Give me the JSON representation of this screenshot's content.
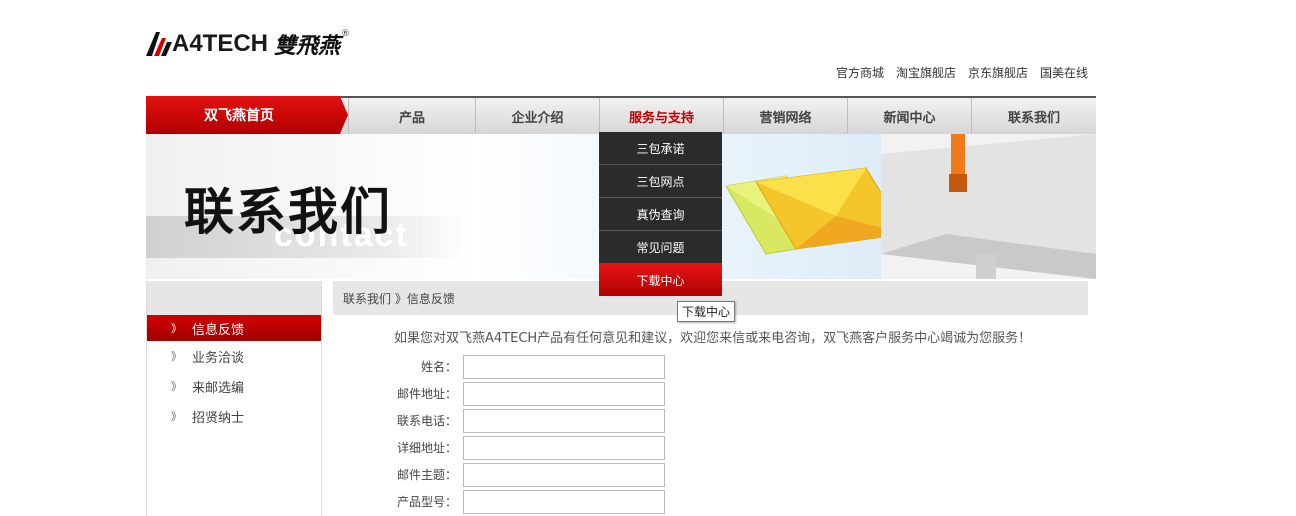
{
  "logo": {
    "text": "A4TECH",
    "cn": "雙飛燕",
    "reg": "®"
  },
  "toplinks": [
    "官方商城",
    "淘宝旗舰店",
    "京东旗舰店",
    "国美在线"
  ],
  "nav": {
    "home": "双飞燕首页",
    "items": [
      "产品",
      "企业介绍",
      "服务与支持",
      "营销网络",
      "新闻中心",
      "联系我们"
    ],
    "active_index": 2
  },
  "dropdown": {
    "items": [
      "三包承诺",
      "三包网点",
      "真伪查询",
      "常见问题",
      "下载中心"
    ],
    "active_index": 4
  },
  "tooltip": "下载中心",
  "banner": {
    "title": "联系我们",
    "subtitle": "contact"
  },
  "sidebar": {
    "items": [
      "信息反馈",
      "业务洽谈",
      "来邮选编",
      "招贤纳士"
    ],
    "active_index": 0,
    "chevron": "》"
  },
  "breadcrumb": "联系我们 》信息反馈",
  "intro": "如果您对双飞燕A4TECH产品有任何意见和建议，欢迎您来信或来电咨询，双飞燕客户服务中心竭诚为您服务！",
  "form": {
    "fields": [
      {
        "label": "姓名：",
        "value": ""
      },
      {
        "label": "邮件地址：",
        "value": ""
      },
      {
        "label": "联系电话：",
        "value": ""
      },
      {
        "label": "详细地址：",
        "value": ""
      },
      {
        "label": "邮件主题：",
        "value": ""
      },
      {
        "label": "产品型号：",
        "value": ""
      }
    ]
  },
  "colors": {
    "accent": "#c00000",
    "dropdown_bg": "#2b2b2b",
    "nav_border": "#555555"
  }
}
